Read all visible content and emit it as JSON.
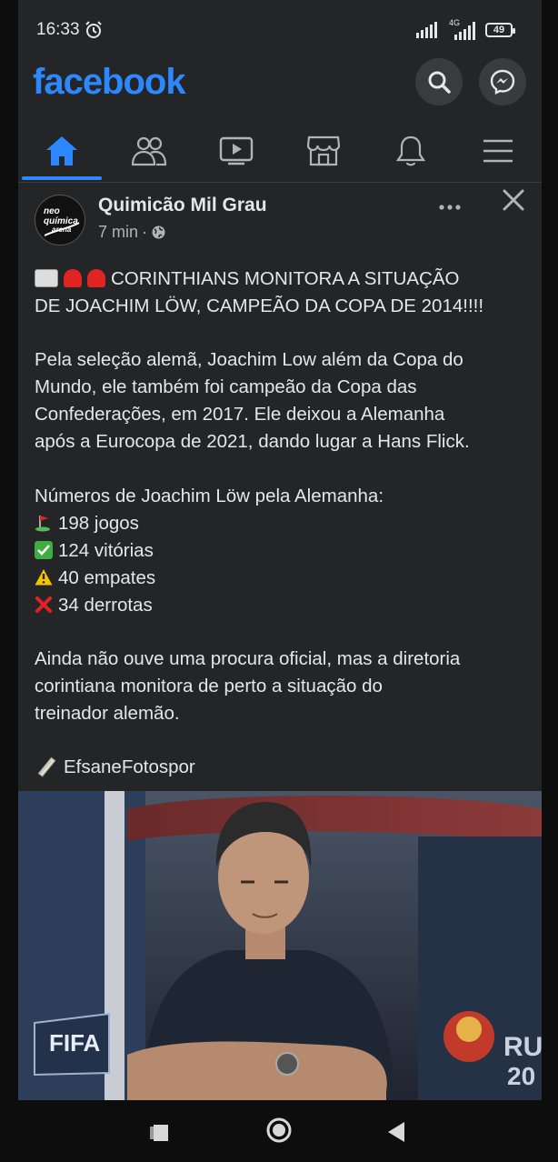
{
  "status": {
    "time": "16:33",
    "network": "4G",
    "battery": "49"
  },
  "app": {
    "logo": "facebook",
    "brand_color": "#2d88ff"
  },
  "nav": {
    "tabs": [
      "home",
      "friends",
      "watch",
      "marketplace",
      "notifications",
      "menu"
    ],
    "active": "home"
  },
  "post": {
    "author": "Quimicão Mil Grau",
    "avatar_text": [
      "neo",
      "química",
      "arena"
    ],
    "time": "7 min",
    "separator": "·",
    "headline_line1": "CORINTHIANS MONITORA A SITUAÇÃO",
    "headline_line2": "DE JOACHIM LÖW, CAMPEÃO DA COPA DE 2014!!!!",
    "para1_lines": [
      "Pela seleção alemã, Joachim Low além da Copa do",
      "Mundo, ele também foi campeão da Copa das",
      "Confederações, em 2017. Ele deixou a Alemanha",
      "após a Eurocopa de 2021, dando lugar a Hans Flick."
    ],
    "stats_title": "Números de Joachim Löw pela Alemanha:",
    "stats": {
      "games": "198 jogos",
      "wins": "124 vitórias",
      "draws": "40 empates",
      "losses": "34 derrotas"
    },
    "para2_lines": [
      "Ainda não ouve uma procura oficial, mas a diretoria",
      "corintiana monitora de perto a situação do",
      "treinador alemão."
    ],
    "credit": "EfsaneFotospor",
    "photo_texts": {
      "fifa": "FIFA",
      "ru": "RU",
      "twenty": "20"
    }
  }
}
